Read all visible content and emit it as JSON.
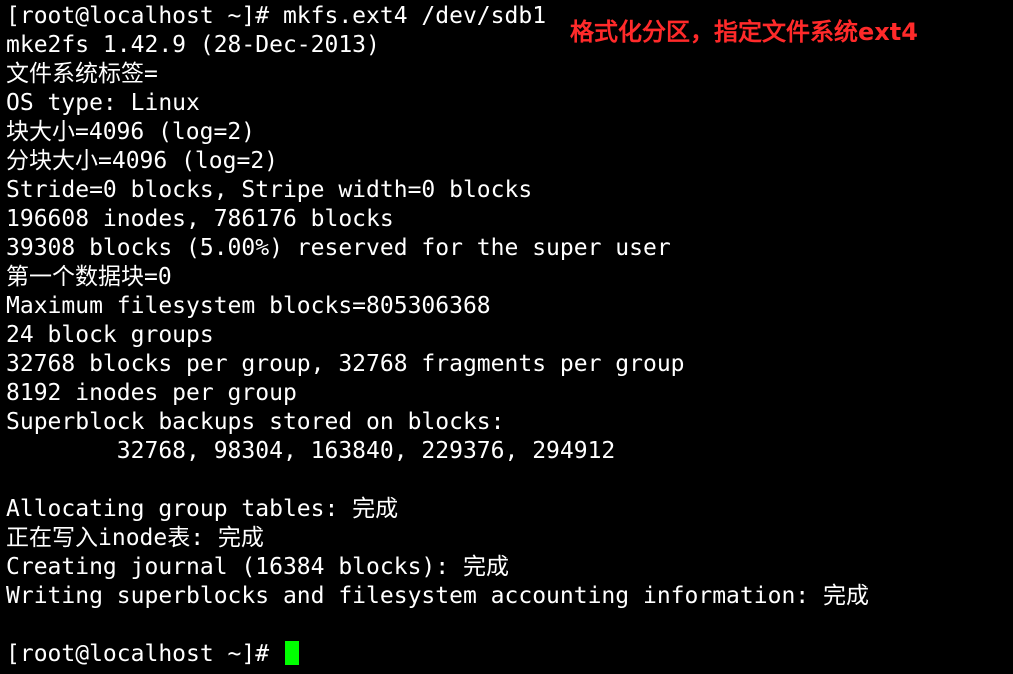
{
  "terminal": {
    "lines": [
      "[root@localhost ~]# mkfs.ext4 /dev/sdb1",
      "mke2fs 1.42.9 (28-Dec-2013)",
      "文件系统标签=",
      "OS type: Linux",
      "块大小=4096 (log=2)",
      "分块大小=4096 (log=2)",
      "Stride=0 blocks, Stripe width=0 blocks",
      "196608 inodes, 786176 blocks",
      "39308 blocks (5.00%) reserved for the super user",
      "第一个数据块=0",
      "Maximum filesystem blocks=805306368",
      "24 block groups",
      "32768 blocks per group, 32768 fragments per group",
      "8192 inodes per group",
      "Superblock backups stored on blocks:",
      "        32768, 98304, 163840, 229376, 294912",
      "",
      "Allocating group tables: 完成",
      "正在写入inode表: 完成",
      "Creating journal (16384 blocks): 完成",
      "Writing superblocks and filesystem accounting information: 完成",
      "",
      "[root@localhost ~]# "
    ],
    "cursor_color": "#00ff00",
    "text_color": "#ffffff",
    "background_color": "#000000"
  },
  "annotation": {
    "text": "格式化分区，指定文件系统ext4",
    "color": "#ff2a2a"
  }
}
